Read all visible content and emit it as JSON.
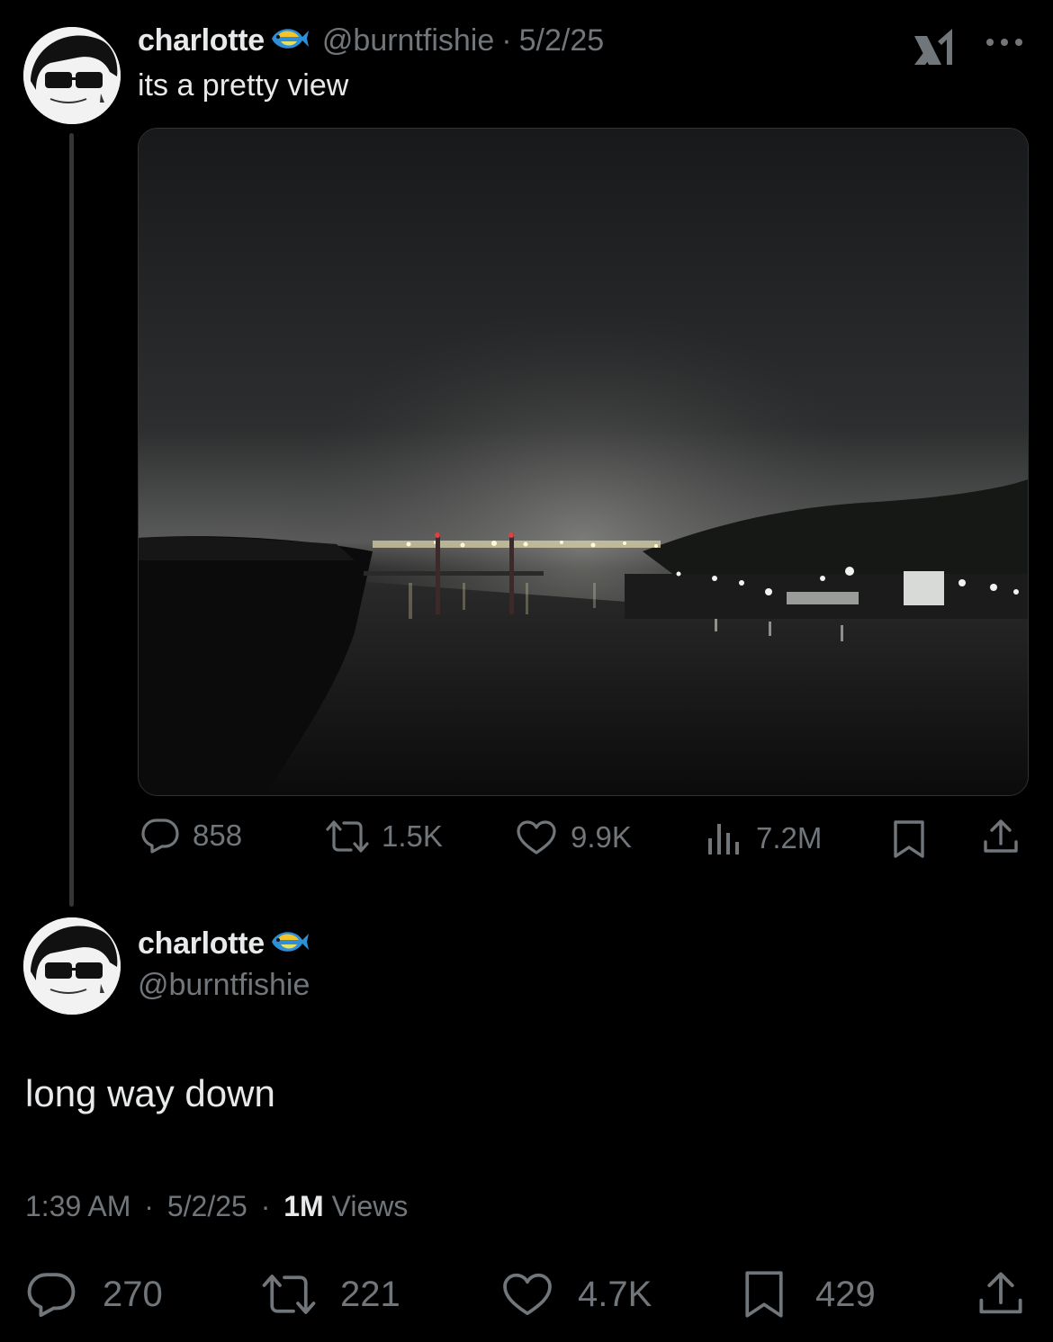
{
  "parent_tweet": {
    "display_name": "charlotte",
    "handle": "@burntfishie",
    "separator": "·",
    "date": "5/2/25",
    "text": "its a pretty view",
    "actions": {
      "replies": "858",
      "retweets": "1.5K",
      "likes": "9.9K",
      "views": "7.2M"
    }
  },
  "reply_tweet": {
    "display_name": "charlotte",
    "handle": "@burntfishie",
    "text": "long way down",
    "time": "1:39 AM",
    "sep1": "·",
    "date": "5/2/25",
    "sep2": "·",
    "views_count": "1M",
    "views_label": "Views",
    "actions": {
      "replies": "270",
      "retweets": "221",
      "likes": "4.7K",
      "bookmarks": "429"
    }
  },
  "colors": {
    "background": "#000000",
    "text_primary": "#e7e9ea",
    "text_secondary": "#71767b",
    "border": "#2f3336"
  },
  "icons": [
    "fish-emoji-icon",
    "grok-icon",
    "more-icon",
    "reply-icon",
    "retweet-icon",
    "like-icon",
    "views-icon",
    "bookmark-icon",
    "share-icon"
  ]
}
